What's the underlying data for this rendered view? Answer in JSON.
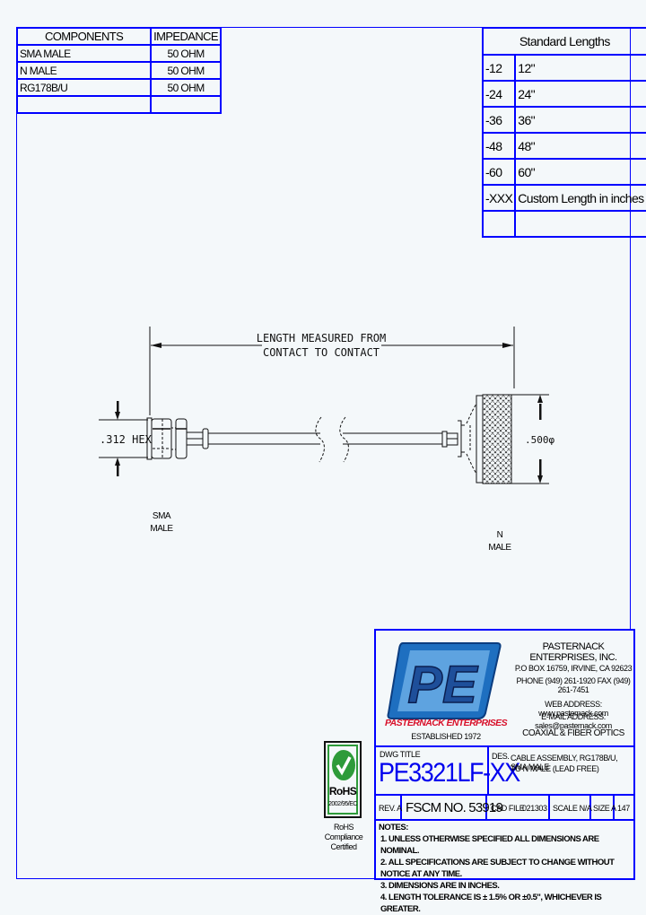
{
  "components_table": {
    "headers": [
      "COMPONENTS",
      "IMPEDANCE"
    ],
    "rows": [
      [
        "SMA MALE",
        "50 OHM"
      ],
      [
        "N MALE",
        "50 OHM"
      ],
      [
        "RG178B/U",
        "50 OHM"
      ],
      [
        "",
        ""
      ]
    ]
  },
  "lengths_table": {
    "title": "Standard Lengths",
    "rows": [
      [
        "-12",
        "12\""
      ],
      [
        "-24",
        "24\""
      ],
      [
        "-36",
        "36\""
      ],
      [
        "-48",
        "48\""
      ],
      [
        "-60",
        "60\""
      ],
      [
        "-XXX",
        "Custom Length in inches"
      ],
      [
        "",
        ""
      ]
    ]
  },
  "drawing": {
    "length_label_line1": "LENGTH MEASURED FROM",
    "length_label_line2": "CONTACT TO CONTACT",
    "left_dimension": ".312 HEX",
    "right_dimension": ".500φ",
    "left_connector_line1": "SMA",
    "left_connector_line2": "MALE",
    "right_connector_line1": "N",
    "right_connector_line2": "MALE"
  },
  "company": {
    "logo_letters": "PE",
    "logo_name": "PASTERNACK ENTERPRISES",
    "established": "ESTABLISHED 1972",
    "name": "PASTERNACK ENTERPRISES, INC.",
    "address": "P.O BOX 16759, IRVINE, CA 92623",
    "phone": "PHONE (949) 261-1920 FAX (949) 261-7451",
    "web": "WEB ADDRESS: www.pasternack.com",
    "email": "E-MAIL ADDRESS: sales@pasternack.com",
    "tagline": "COAXIAL & FIBER OPTICS"
  },
  "rohs": {
    "label": "RoHS",
    "directive": "2002/95/EC",
    "caption_line1": "RoHS",
    "caption_line2": "Compliance",
    "caption_line3": "Certified",
    "check_color": "#2e9b3a"
  },
  "title_block": {
    "dwg_title_label": "DWG TITLE",
    "part_number": "PE3321LF-XX",
    "des_label": "DES.",
    "description_line1": "CABLE ASSEMBLY, RG178B/U, SMA MALE",
    "description_line2": "TO N MALE (LEAD FREE)",
    "rev": "REV. A",
    "fscm": "FSCM NO. 53919",
    "cad_file_label": "CAD FILE",
    "cad_file": "021303",
    "scale": "SCALE N/A",
    "size": "SIZE A",
    "sheet": "147"
  },
  "notes": {
    "title": "NOTES:",
    "items": [
      "1. UNLESS OTHERWISE SPECIFIED ALL DIMENSIONS ARE NOMINAL.",
      "2. ALL SPECIFICATIONS ARE SUBJECT TO CHANGE WITHOUT NOTICE AT ANY TIME.",
      "3. DIMENSIONS ARE IN INCHES.",
      "4. LENGTH TOLERANCE IS ± 1.5% OR ±0.5\", WHICHEVER IS GREATER."
    ]
  },
  "colors": {
    "border_blue": "#0000ff",
    "part_number_blue": "#0000ee",
    "logo_red": "#d8102a",
    "logo_blue": "#1e6fc0"
  }
}
